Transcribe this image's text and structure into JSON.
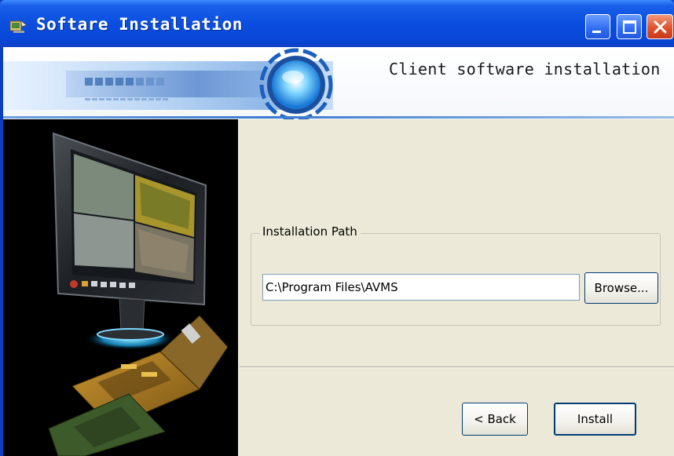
{
  "window": {
    "title": "Softare Installation",
    "controls": [
      "minimize",
      "maximize",
      "close"
    ]
  },
  "banner": {
    "heading": "Client software installation"
  },
  "install_path": {
    "group_label": "Installation Path",
    "value": "C:\\Program Files\\AVMS",
    "browse_label": "Browse..."
  },
  "footer": {
    "back_label": "< Back",
    "install_label": "Install"
  },
  "icons": {
    "app": "installer-app-icon",
    "minimize": "minimize-icon",
    "maximize": "maximize-icon",
    "close": "close-icon"
  },
  "colors": {
    "titlebar": "#0a4ee0",
    "dialog_bg": "#ece9d8",
    "close_button": "#e0522a",
    "button_border": "#003c74"
  }
}
